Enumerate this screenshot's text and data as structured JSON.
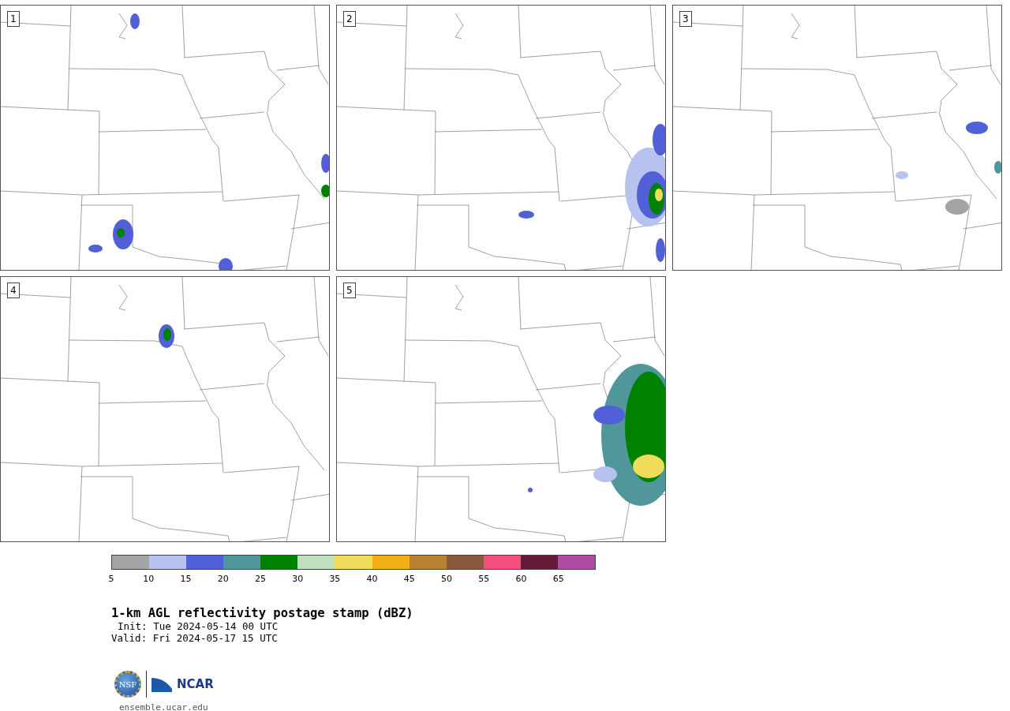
{
  "panels": [
    {
      "label": "1"
    },
    {
      "label": "2"
    },
    {
      "label": "3"
    },
    {
      "label": "4"
    },
    {
      "label": "5"
    }
  ],
  "colorbar": {
    "bins": [
      {
        "color": "#a4a4a4"
      },
      {
        "color": "#b8c2ee"
      },
      {
        "color": "#5260d8"
      },
      {
        "color": "#50969b"
      },
      {
        "color": "#008200"
      },
      {
        "color": "#bfdfbf"
      },
      {
        "color": "#f0dc5a"
      },
      {
        "color": "#f0af14"
      },
      {
        "color": "#b98232"
      },
      {
        "color": "#8b5a3c"
      },
      {
        "color": "#f5507d"
      },
      {
        "color": "#641937"
      },
      {
        "color": "#af4ba5"
      }
    ],
    "ticks": [
      "5",
      "10",
      "15",
      "20",
      "25",
      "30",
      "35",
      "40",
      "45",
      "50",
      "55",
      "60",
      "65"
    ]
  },
  "title": "1-km AGL reflectivity postage stamp (dBZ)",
  "info_lines": [
    "Init: Tue 2024-05-14 00 UTC",
    "Valid: Fri 2024-05-17 15 UTC"
  ],
  "logo": {
    "nsf": "NSF",
    "ncar": "NCAR"
  },
  "url": "ensemble.ucar.edu"
}
